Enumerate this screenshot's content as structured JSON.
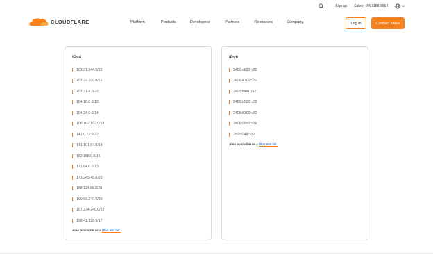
{
  "topbar": {
    "search_icon": "search-icon",
    "signup": "Sign up",
    "sales": "Sales: +65 3158 3954",
    "globe_icon": "globe-icon"
  },
  "nav": {
    "logo_text": "CLOUDFLARE",
    "links": [
      "Platform",
      "Products",
      "Developers",
      "Partners",
      "Resources",
      "Company"
    ],
    "login": "Log in",
    "contact": "Contact sales"
  },
  "ipv4": {
    "title": "IPv4",
    "ranges": [
      "103.21.244.0/22",
      "103.22.200.0/22",
      "103.31.4.0/22",
      "104.16.0.0/13",
      "104.24.0.0/14",
      "108.162.192.0/18",
      "141.0.72.0/22",
      "141.101.64.0/18",
      "162.158.0.0/15",
      "172.64.0.0/13",
      "173.245.48.0/20",
      "188.114.96.0/20",
      "190.93.240.0/20",
      "197.234.240.0/22",
      "198.41.128.0/17"
    ],
    "also_prefix": "Also available as a",
    "also_link": "IPv4 text list."
  },
  "ipv6": {
    "title": "IPv6",
    "ranges": [
      "2400:cb00::/32",
      "2606:4700::/32",
      "2803:f800::/32",
      "2405:b500::/32",
      "2405:8100::/32",
      "2a06:98c0::/29",
      "2c0f:f248::/32"
    ],
    "also_prefix": "Also available as a",
    "also_link": "IPv6 text list."
  },
  "colors": {
    "accent": "#f38020",
    "button_fill": "#f6821f",
    "link": "#0051c3"
  }
}
